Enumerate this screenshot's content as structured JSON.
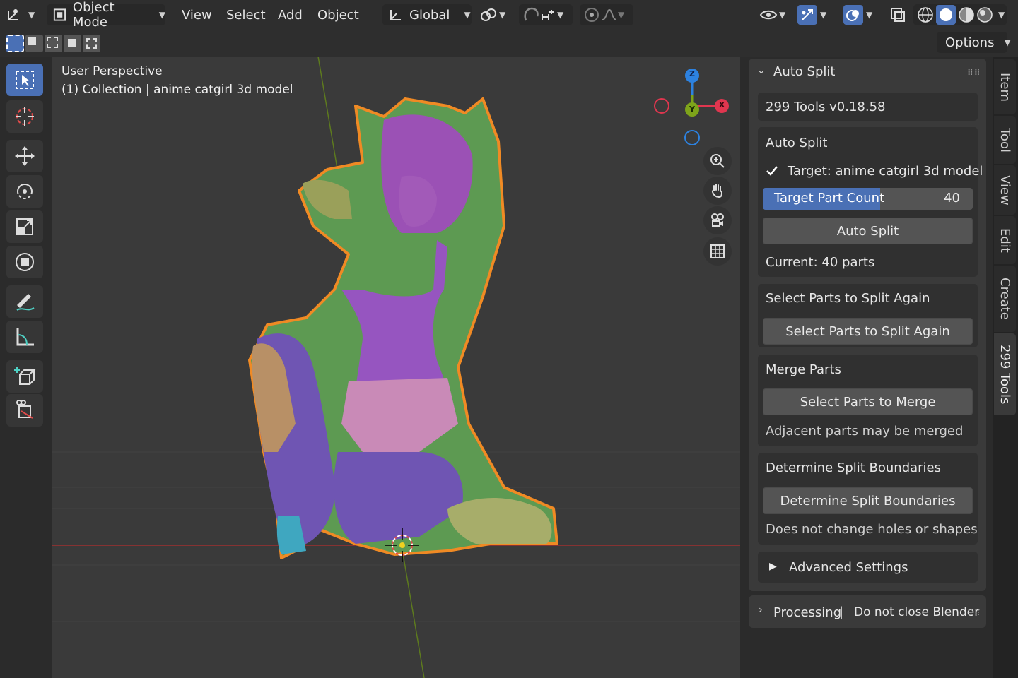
{
  "header": {
    "mode_label": "Object Mode",
    "menus": [
      "View",
      "Select",
      "Add",
      "Object"
    ],
    "orientation_label": "Global",
    "options_label": "Options"
  },
  "viewport": {
    "perspective_label": "User Perspective",
    "collection_label": "(1) Collection | anime catgirl 3d model",
    "gizmo": {
      "z": "Z",
      "y": "Y",
      "x": "X"
    }
  },
  "panel": {
    "title": "Auto Split",
    "version": "299 Tools  v0.18.58",
    "auto_split": {
      "section_title": "Auto Split",
      "target_label": "Target: anime catgirl 3d model",
      "target_checked": true,
      "slider_label": "Target Part Count",
      "slider_value": "40",
      "slider_fraction": 0.56,
      "button_label": "Auto Split",
      "current_label": "Current: 40 parts"
    },
    "split_again": {
      "section_title": "Select Parts to Split Again",
      "button_label": "Select Parts to Split Again"
    },
    "merge": {
      "section_title": "Merge Parts",
      "button_label": "Select Parts to Merge",
      "note": "Adjacent parts may be merged"
    },
    "boundaries": {
      "section_title": "Determine Split Boundaries",
      "button_label": "Determine Split Boundaries",
      "note": "Does not change holes or shapes"
    },
    "advanced_label": "Advanced Settings"
  },
  "processing": {
    "label": "Processing",
    "separator": "|",
    "message": "Do not close Blender"
  },
  "tabs": [
    "Item",
    "Tool",
    "View",
    "Edit",
    "Create",
    "299 Tools"
  ],
  "active_tab": "299 Tools",
  "colors": {
    "accent": "#4a70b5",
    "selection_outline": "#f08a24",
    "axis_x": "#e0364f",
    "axis_y": "#7ea41a",
    "axis_z": "#2d82e0"
  }
}
